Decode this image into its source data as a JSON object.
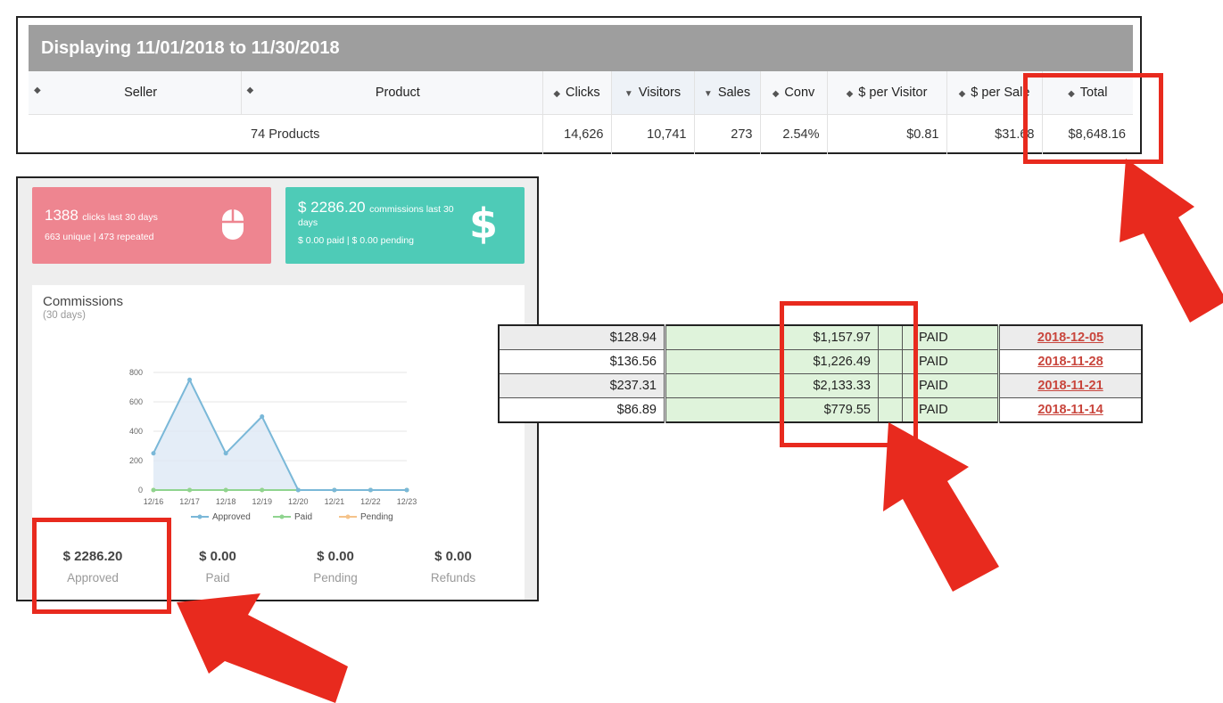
{
  "report": {
    "header": "Displaying 11/01/2018 to 11/30/2018",
    "columns": [
      "Seller",
      "Product",
      "Clicks",
      "Visitors",
      "Sales",
      "Conv",
      "$ per Visitor",
      "$ per Sale",
      "Total"
    ],
    "row": {
      "product": "74 Products",
      "clicks": "14,626",
      "visitors": "10,741",
      "sales": "273",
      "conv": "2.54%",
      "per_visitor": "$0.81",
      "per_sale": "$31.68",
      "total": "$8,648.16"
    }
  },
  "stats": {
    "clicks_count": "1388",
    "clicks_label": "clicks last 30 days",
    "clicks_detail": "663 unique | 473 repeated",
    "commissions_amount": "$ 2286.20",
    "commissions_label": "commissions last 30 days",
    "commissions_detail": "$ 0.00 paid | $ 0.00 pending"
  },
  "commissions_chart": {
    "title": "Commissions",
    "subtitle": "(30 days)",
    "legend": [
      "Approved",
      "Paid",
      "Pending"
    ],
    "colors": {
      "approved": "#7ab8d8",
      "paid": "#8fd48f",
      "pending": "#f5c38a",
      "approved_fill": "#dde9f5"
    }
  },
  "chart_data": {
    "type": "line",
    "x": [
      "12/16",
      "12/17",
      "12/18",
      "12/19",
      "12/20",
      "12/21",
      "12/22",
      "12/23"
    ],
    "series": [
      {
        "name": "Approved",
        "values": [
          250,
          750,
          250,
          500,
          0,
          0,
          0,
          0
        ]
      },
      {
        "name": "Paid",
        "values": [
          0,
          0,
          0,
          0,
          0,
          0,
          0,
          0
        ]
      },
      {
        "name": "Pending",
        "values": [
          0,
          0,
          0,
          0,
          0,
          0,
          0,
          0
        ]
      }
    ],
    "ylim": [
      0,
      800
    ],
    "yticks": [
      0,
      200,
      400,
      600,
      800
    ],
    "grid": true,
    "legend": "bottom"
  },
  "summary": [
    {
      "amount": "$ 2286.20",
      "label": "Approved"
    },
    {
      "amount": "$ 0.00",
      "label": "Paid"
    },
    {
      "amount": "$ 0.00",
      "label": "Pending"
    },
    {
      "amount": "$ 0.00",
      "label": "Refunds"
    }
  ],
  "payments": [
    {
      "amount": "$128.94",
      "total": "$1,157.97",
      "status": "PAID",
      "date": "2018-12-05"
    },
    {
      "amount": "$136.56",
      "total": "$1,226.49",
      "status": "PAID",
      "date": "2018-11-28"
    },
    {
      "amount": "$237.31",
      "total": "$2,133.33",
      "status": "PAID",
      "date": "2018-11-21"
    },
    {
      "amount": "$86.89",
      "total": "$779.55",
      "status": "PAID",
      "date": "2018-11-14"
    }
  ],
  "annotation_color": "#e82a1e"
}
